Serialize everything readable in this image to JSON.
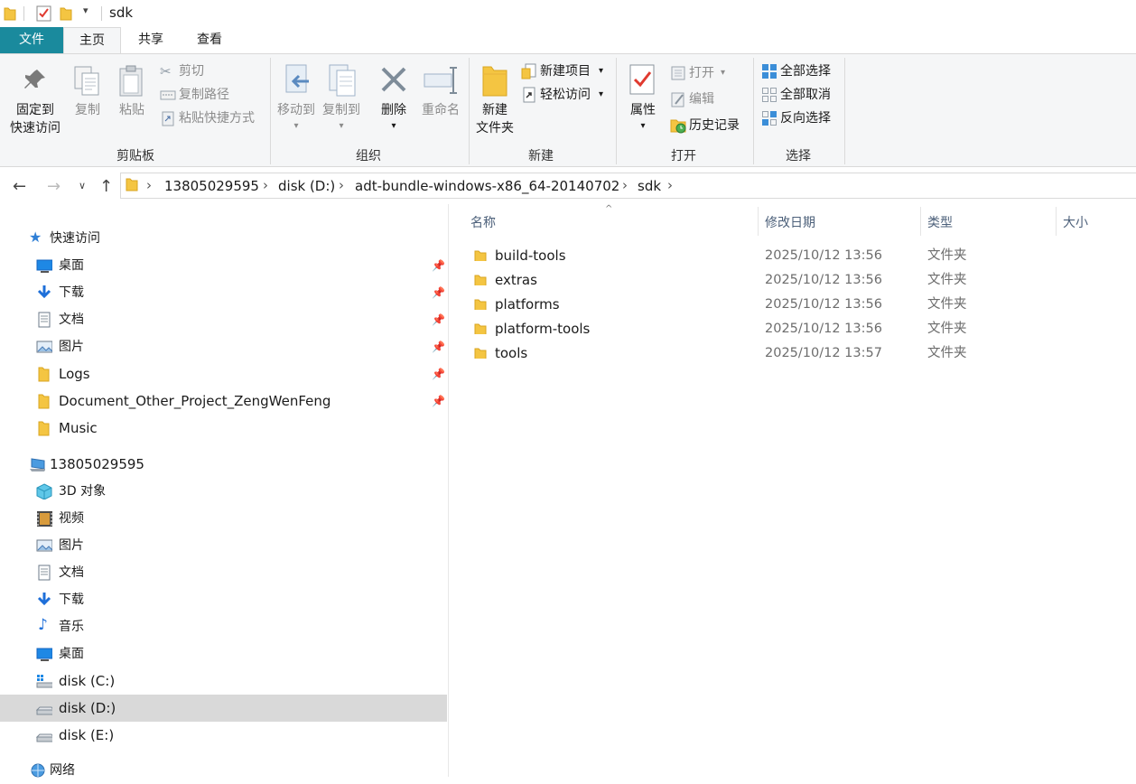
{
  "window": {
    "title": "sdk"
  },
  "tabs": {
    "file": "文件",
    "home": "主页",
    "share": "共享",
    "view": "查看"
  },
  "ribbon": {
    "clipboard": {
      "label": "剪贴板",
      "pin": "固定到\n快速访问",
      "pin_l1": "固定到",
      "pin_l2": "快速访问",
      "copy": "复制",
      "paste": "粘贴",
      "cut": "剪切",
      "copy_path": "复制路径",
      "paste_shortcut": "粘贴快捷方式"
    },
    "organize": {
      "label": "组织",
      "move_to": "移动到",
      "copy_to": "复制到",
      "delete": "删除",
      "rename": "重命名"
    },
    "new": {
      "label": "新建",
      "new_folder_l1": "新建",
      "new_folder_l2": "文件夹",
      "new_item": "新建项目",
      "easy_access": "轻松访问"
    },
    "open": {
      "label": "打开",
      "properties": "属性",
      "open": "打开",
      "edit": "编辑",
      "history": "历史记录"
    },
    "select": {
      "label": "选择",
      "select_all": "全部选择",
      "select_none": "全部取消",
      "invert": "反向选择"
    }
  },
  "address": {
    "crumbs": [
      "13805029595",
      "disk (D:)",
      "adt-bundle-windows-x86_64-20140702",
      "sdk"
    ]
  },
  "nav": {
    "quick_access": "快速访问",
    "quick_items": [
      "桌面",
      "下载",
      "文档",
      "图片",
      "Logs",
      "Document_Other_Project_ZengWenFeng",
      "Music"
    ],
    "this_pc": "13805029595",
    "pc_items": [
      "3D 对象",
      "视频",
      "图片",
      "文档",
      "下载",
      "音乐",
      "桌面",
      "disk (C:)",
      "disk (D:)",
      "disk (E:)"
    ],
    "network": "网络"
  },
  "columns": {
    "name": "名称",
    "modified": "修改日期",
    "type": "类型",
    "size": "大小"
  },
  "files": [
    {
      "name": "build-tools",
      "modified": "2025/10/12 13:56",
      "type": "文件夹"
    },
    {
      "name": "extras",
      "modified": "2025/10/12 13:56",
      "type": "文件夹"
    },
    {
      "name": "platforms",
      "modified": "2025/10/12 13:56",
      "type": "文件夹"
    },
    {
      "name": "platform-tools",
      "modified": "2025/10/12 13:56",
      "type": "文件夹"
    },
    {
      "name": "tools",
      "modified": "2025/10/12 13:57",
      "type": "文件夹"
    }
  ],
  "colors": {
    "file_tab": "#1a8a9d",
    "folder": "#f4c542",
    "selection": "#d9d9d9"
  }
}
